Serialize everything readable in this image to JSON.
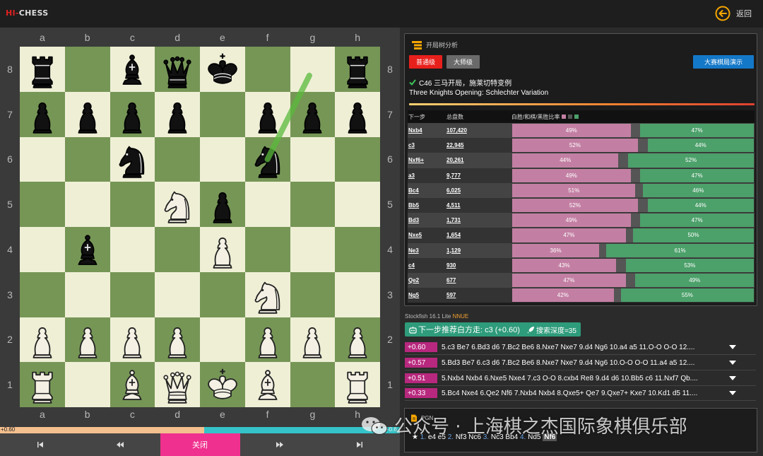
{
  "app": {
    "logo_prefix": "HI",
    "logo_sep": "-",
    "logo_suffix": "CHESS",
    "back_label": "返回"
  },
  "board": {
    "files": [
      "a",
      "b",
      "c",
      "d",
      "e",
      "f",
      "g",
      "h"
    ],
    "ranks": [
      "8",
      "7",
      "6",
      "5",
      "4",
      "3",
      "2",
      "1"
    ],
    "position": [
      [
        "bR",
        "",
        "bB",
        "bQ",
        "bK",
        "",
        "",
        "bR"
      ],
      [
        "bP",
        "bP",
        "bP",
        "bP",
        "",
        "bP",
        "bP",
        "bP"
      ],
      [
        "",
        "",
        "bN",
        "",
        "",
        "bN",
        "",
        ""
      ],
      [
        "",
        "",
        "",
        "wN",
        "bP",
        "",
        "",
        ""
      ],
      [
        "",
        "bB",
        "",
        "",
        "wP",
        "",
        "",
        ""
      ],
      [
        "",
        "",
        "",
        "",
        "",
        "wN",
        "",
        ""
      ],
      [
        "wP",
        "wP",
        "wP",
        "wP",
        "",
        "wP",
        "wP",
        "wP"
      ],
      [
        "wR",
        "",
        "wB",
        "wQ",
        "wK",
        "wB",
        "",
        "wR"
      ]
    ],
    "arrow": {
      "from": "f6",
      "to": "g8",
      "color": "#5aba3c"
    }
  },
  "eval": {
    "left_label": "+0.60",
    "right_label": "-0.6",
    "white_fraction": 0.51
  },
  "nav": {
    "first": "first",
    "prev": "prev",
    "close_label": "关闭",
    "next": "next",
    "last": "last"
  },
  "opening": {
    "header": "开局树分析",
    "btn_normal": "普通级",
    "btn_master": "大师级",
    "btn_demo": "大赛棋局演示",
    "code_line": "C46 三马开局，施莱切特变例",
    "name_en": "Three Knights Opening: Schlechter Variation",
    "col_move": "下一步",
    "col_total": "总盘数",
    "col_ratio": "白胜/和棋/黑胜比率",
    "colors": {
      "white": "#c37fa3",
      "draw": "#555555",
      "black": "#4ca06a"
    },
    "rows": [
      {
        "move": "Nxb4",
        "count": "107,420",
        "w": 49,
        "d": 4,
        "b": 47,
        "w_label": "49%",
        "b_label": "47%"
      },
      {
        "move": "c3",
        "count": "22,945",
        "w": 52,
        "d": 4,
        "b": 44,
        "w_label": "52%",
        "b_label": "44%"
      },
      {
        "move": "Nxf6+",
        "count": "20,261",
        "w": 44,
        "d": 4,
        "b": 52,
        "w_label": "44%",
        "b_label": "52%"
      },
      {
        "move": "a3",
        "count": "9,777",
        "w": 49,
        "d": 4,
        "b": 47,
        "w_label": "49%",
        "b_label": "47%"
      },
      {
        "move": "Bc4",
        "count": "6,025",
        "w": 51,
        "d": 3,
        "b": 46,
        "w_label": "51%",
        "b_label": "46%"
      },
      {
        "move": "Bb5",
        "count": "4,511",
        "w": 52,
        "d": 4,
        "b": 44,
        "w_label": "52%",
        "b_label": "44%"
      },
      {
        "move": "Bd3",
        "count": "1,731",
        "w": 49,
        "d": 4,
        "b": 47,
        "w_label": "49%",
        "b_label": "47%"
      },
      {
        "move": "Nxe5",
        "count": "1,654",
        "w": 47,
        "d": 3,
        "b": 50,
        "w_label": "47%",
        "b_label": "50%"
      },
      {
        "move": "Ne3",
        "count": "1,129",
        "w": 36,
        "d": 3,
        "b": 61,
        "w_label": "36%",
        "b_label": "61%"
      },
      {
        "move": "c4",
        "count": "930",
        "w": 43,
        "d": 4,
        "b": 53,
        "w_label": "43%",
        "b_label": "53%"
      },
      {
        "move": "Qe2",
        "count": "677",
        "w": 47,
        "d": 4,
        "b": 49,
        "w_label": "47%",
        "b_label": "49%"
      },
      {
        "move": "Ng5",
        "count": "597",
        "w": 42,
        "d": 3,
        "b": 55,
        "w_label": "42%",
        "b_label": "55%"
      }
    ]
  },
  "engine": {
    "name": "Stockfish 16.1 Lite ",
    "nnue": "NNUE",
    "best_label": "下一步推荐白方走: c3 (+0.60)",
    "depth_label": "搜索深度=35",
    "lines": [
      {
        "score": "+0.60",
        "moves": "5.c3 Be7 6.Bd3 d6 7.Bc2 Be6 8.Nxe7 Nxe7 9.d4 Ng6 10.a4 a5 11.O-O O-O 12...."
      },
      {
        "score": "+0.57",
        "moves": "5.Bd3 Be7 6.c3 d6 7.Bc2 Be6 8.Nxe7 Nxe7 9.d4 Ng6 10.O-O O-O 11.a4 a5 12...."
      },
      {
        "score": "+0.51",
        "moves": "5.Nxb4 Nxb4 6.Nxe5 Nxe4 7.c3 O-O 8.cxb4 Re8 9.d4 d6 10.Bb5 c6 11.Nxf7 Qb...."
      },
      {
        "score": "+0.33",
        "moves": "5.Bc4 Nxe4 6.Qe2 Nf6 7.Nxb4 Nxb4 8.Qxe5+ Qe7 9.Qxe7+ Kxe7 10.Kd1 d5 11...."
      }
    ]
  },
  "pgn": {
    "header": "PGN",
    "star": "★",
    "moves": [
      {
        "num": "1.",
        "san": "e4 e5"
      },
      {
        "num": "2.",
        "san": "Nf3 Nc6"
      },
      {
        "num": "3.",
        "san": "Nc3 Bb4"
      },
      {
        "num": "4.",
        "san": "Nd5"
      }
    ],
    "current": "Nf6"
  },
  "watermark": {
    "text": "公众号 · 上海棋之杰国际象棋俱乐部"
  }
}
